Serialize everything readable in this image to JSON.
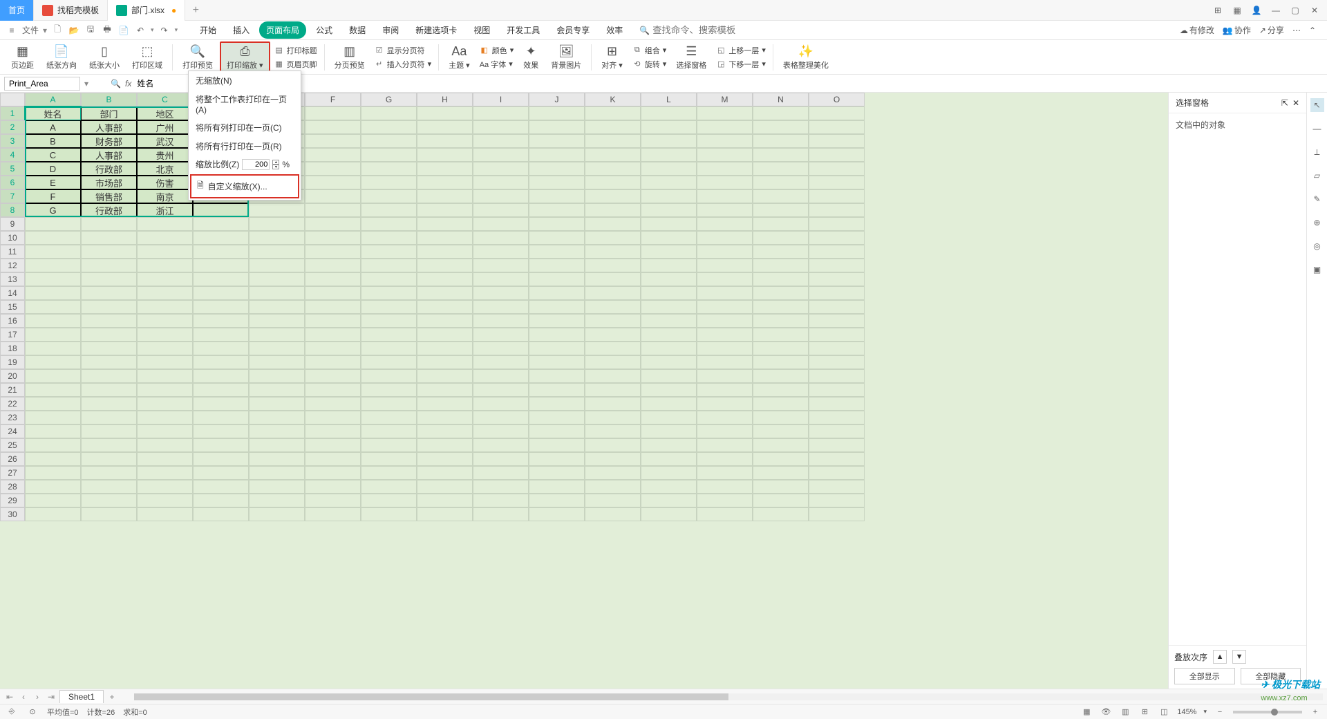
{
  "tabs": {
    "home": "首页",
    "template": "找稻壳模板",
    "file": "部门.xlsx",
    "modified": "●"
  },
  "window_controls": {
    "layout": "⊞",
    "grid": "▦",
    "avatar": "👤",
    "min": "—",
    "max": "▢",
    "close": "✕"
  },
  "qat": {
    "menu": "≡",
    "file_label": "文件",
    "new": "🗋",
    "open": "📂",
    "save": "🖫",
    "print": "🖶",
    "print2": "📄",
    "undo": "↶",
    "redo": "↷"
  },
  "menu": {
    "start": "开始",
    "insert": "插入",
    "page_layout": "页面布局",
    "formula": "公式",
    "data": "数据",
    "review": "审阅",
    "new_tab": "新建选项卡",
    "view": "视图",
    "dev": "开发工具",
    "member": "会员专享",
    "efficiency": "效率"
  },
  "search": {
    "placeholder": "查找命令、搜索模板",
    "icon": "🔍"
  },
  "menubar_right": {
    "cloud_icon": "☁",
    "cloud_text": "有修改",
    "coop_icon": "👥",
    "coop_text": "协作",
    "share_icon": "↗",
    "share_text": "分享",
    "more": "⋯",
    "chevron": "⌃"
  },
  "ribbon": {
    "margins": "页边距",
    "orientation": "纸张方向",
    "size": "纸张大小",
    "area": "打印区域",
    "preview": "打印预览",
    "scale": "打印缩放",
    "titles_label": "打印标题",
    "header_footer": "页眉页脚",
    "page_preview": "分页预览",
    "show_breaks": "显示分页符",
    "insert_break": "插入分页符",
    "theme": "主题",
    "fonts": "Aa 字体",
    "colors": "颜色",
    "effects": "效果",
    "bg": "背景图片",
    "align": "对齐",
    "group": "组合",
    "rotate": "旋转",
    "select_pane": "选择窗格",
    "up_layer": "上移一层",
    "down_layer": "下移一层",
    "beautify": "表格整理美化"
  },
  "dropdown": {
    "none": "无缩放(N)",
    "fit_sheet": "将整个工作表打印在一页(A)",
    "fit_cols": "将所有列打印在一页(C)",
    "fit_rows": "将所有行打印在一页(R)",
    "zoom_label": "缩放比例(Z)",
    "zoom_value": "200",
    "zoom_pct": "%",
    "custom": "自定义缩放(X)..."
  },
  "formula_bar": {
    "name_box": "Print_Area",
    "formula": "姓名"
  },
  "columns": [
    "A",
    "B",
    "C",
    "D",
    "E",
    "F",
    "G",
    "H",
    "I",
    "J",
    "K",
    "L",
    "M",
    "N",
    "O"
  ],
  "rows_count": 30,
  "headers": [
    "姓名",
    "部门",
    "地区"
  ],
  "table": [
    [
      "A",
      "人事部",
      "广州"
    ],
    [
      "B",
      "财务部",
      "武汉"
    ],
    [
      "C",
      "人事部",
      "贵州"
    ],
    [
      "D",
      "行政部",
      "北京"
    ],
    [
      "E",
      "市场部",
      "伤害"
    ],
    [
      "F",
      "销售部",
      "南京"
    ],
    [
      "G",
      "行政部",
      "浙江"
    ]
  ],
  "right_panel": {
    "title": "选择窗格",
    "body": "文档中的对象",
    "stack_label": "叠放次序",
    "up": "▲",
    "down": "▼",
    "show_all": "全部显示",
    "hide_all": "全部隐藏",
    "pin": "⇱",
    "close": "✕"
  },
  "rtool": {
    "cursor": "↖",
    "line": "—",
    "ruler": "⟂",
    "shape": "▱",
    "style": "✎",
    "chain": "⊕",
    "mark": "◎",
    "vid": "▣"
  },
  "sheet_tabs": {
    "sheet1": "Sheet1",
    "add": "+"
  },
  "statusbar": {
    "input_icon": "⎆",
    "avg": "平均值=0",
    "count": "计数=26",
    "sum": "求和=0",
    "zoom_label": "145%",
    "minus": "−",
    "plus": "+"
  },
  "watermark": {
    "brand": "极光下载站",
    "url": "www.xz7.com"
  }
}
